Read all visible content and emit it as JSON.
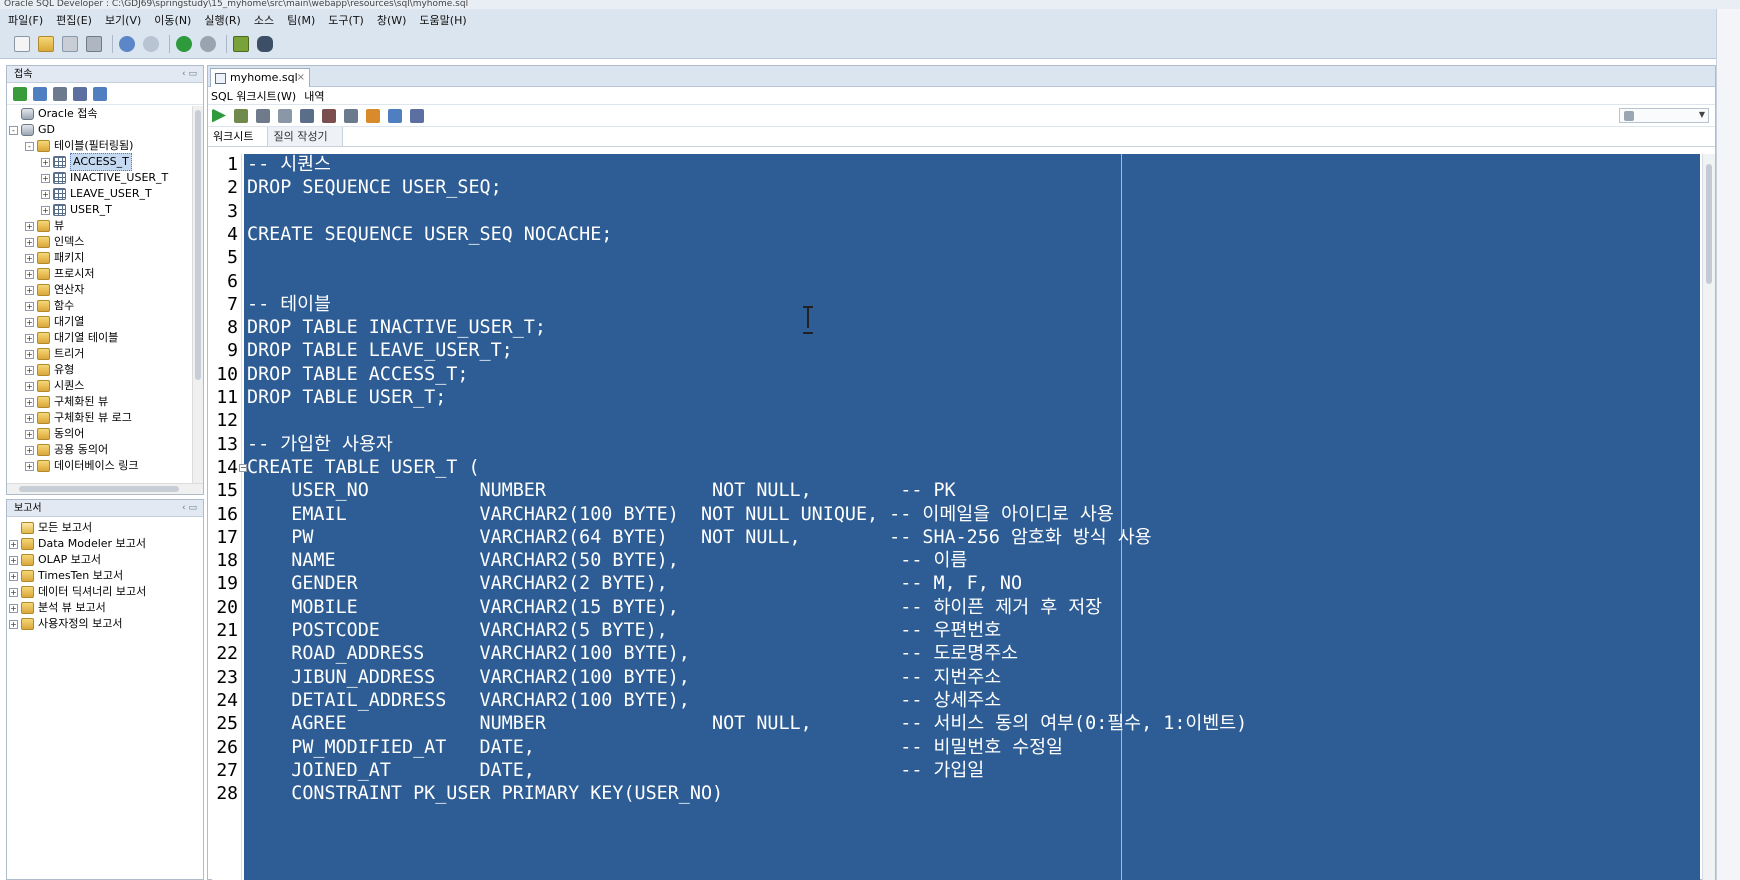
{
  "window": {
    "title": "Oracle SQL Developer : C:\\GDJ69\\springstudy\\15_myhome\\src\\main\\webapp\\resources\\sql\\myhome.sql"
  },
  "menu": [
    "파일(F)",
    "편집(E)",
    "보기(V)",
    "이동(N)",
    "실행(R)",
    "소스",
    "팀(M)",
    "도구(T)",
    "창(W)",
    "도움말(H)"
  ],
  "connections_panel": {
    "title": "접속",
    "tree": [
      {
        "label": "Oracle 접속",
        "level": 0,
        "icon": "db",
        "toggle": ""
      },
      {
        "label": "GD",
        "level": 0,
        "icon": "db",
        "toggle": "-"
      },
      {
        "label": "테이블(필터링됨)",
        "level": 1,
        "icon": "folder",
        "toggle": "-"
      },
      {
        "label": "ACCESS_T",
        "level": 2,
        "icon": "table",
        "toggle": "+",
        "selected": true
      },
      {
        "label": "INACTIVE_USER_T",
        "level": 2,
        "icon": "table",
        "toggle": "+"
      },
      {
        "label": "LEAVE_USER_T",
        "level": 2,
        "icon": "table",
        "toggle": "+"
      },
      {
        "label": "USER_T",
        "level": 2,
        "icon": "table",
        "toggle": "+"
      },
      {
        "label": "뷰",
        "level": 1,
        "icon": "folder",
        "toggle": "+"
      },
      {
        "label": "인덱스",
        "level": 1,
        "icon": "folder",
        "toggle": "+"
      },
      {
        "label": "패키지",
        "level": 1,
        "icon": "folder",
        "toggle": "+"
      },
      {
        "label": "프로시저",
        "level": 1,
        "icon": "folder",
        "toggle": "+"
      },
      {
        "label": "연산자",
        "level": 1,
        "icon": "folder",
        "toggle": "+"
      },
      {
        "label": "함수",
        "level": 1,
        "icon": "folder",
        "toggle": "+"
      },
      {
        "label": "대기열",
        "level": 1,
        "icon": "folder",
        "toggle": "+"
      },
      {
        "label": "대기열 테이블",
        "level": 1,
        "icon": "folder",
        "toggle": "+"
      },
      {
        "label": "트리거",
        "level": 1,
        "icon": "folder",
        "toggle": "+"
      },
      {
        "label": "유형",
        "level": 1,
        "icon": "folder",
        "toggle": "+"
      },
      {
        "label": "시퀀스",
        "level": 1,
        "icon": "folder",
        "toggle": "+"
      },
      {
        "label": "구체화된 뷰",
        "level": 1,
        "icon": "folder",
        "toggle": "+"
      },
      {
        "label": "구체화된 뷰 로그",
        "level": 1,
        "icon": "folder",
        "toggle": "+"
      },
      {
        "label": "동의어",
        "level": 1,
        "icon": "folder",
        "toggle": "+"
      },
      {
        "label": "공용 동의어",
        "level": 1,
        "icon": "folder",
        "toggle": "+"
      },
      {
        "label": "데이터베이스 링크",
        "level": 1,
        "icon": "folder",
        "toggle": "+"
      }
    ]
  },
  "reports_panel": {
    "title": "보고서",
    "tree": [
      {
        "label": "모든 보고서",
        "level": 0,
        "icon": "report",
        "toggle": ""
      },
      {
        "label": "Data Modeler 보고서",
        "level": 0,
        "icon": "folder",
        "toggle": "+"
      },
      {
        "label": "OLAP 보고서",
        "level": 0,
        "icon": "folder",
        "toggle": "+"
      },
      {
        "label": "TimesTen 보고서",
        "level": 0,
        "icon": "folder",
        "toggle": "+"
      },
      {
        "label": "데이터 딕셔너리 보고서",
        "level": 0,
        "icon": "folder",
        "toggle": "+"
      },
      {
        "label": "분석 뷰 보고서",
        "level": 0,
        "icon": "folder",
        "toggle": "+"
      },
      {
        "label": "사용자정의 보고서",
        "level": 0,
        "icon": "folder",
        "toggle": "+"
      }
    ]
  },
  "editor": {
    "file_tab": "myhome.sql",
    "sub_tabs": [
      "SQL 워크시트(W)",
      "내역"
    ],
    "worksheet_tabs": [
      "워크시트",
      "질의 작성기"
    ],
    "lines": [
      {
        "n": "1",
        "text": "-- 시퀀스"
      },
      {
        "n": "2",
        "text": "DROP SEQUENCE USER_SEQ;"
      },
      {
        "n": "3",
        "text": ""
      },
      {
        "n": "4",
        "text": "CREATE SEQUENCE USER_SEQ NOCACHE;"
      },
      {
        "n": "5",
        "text": ""
      },
      {
        "n": "6",
        "text": ""
      },
      {
        "n": "7",
        "text": "-- 테이블"
      },
      {
        "n": "8",
        "text": "DROP TABLE INACTIVE_USER_T;"
      },
      {
        "n": "9",
        "text": "DROP TABLE LEAVE_USER_T;"
      },
      {
        "n": "10",
        "text": "DROP TABLE ACCESS_T;"
      },
      {
        "n": "11",
        "text": "DROP TABLE USER_T;"
      },
      {
        "n": "12",
        "text": ""
      },
      {
        "n": "13",
        "text": "-- 가입한 사용자"
      },
      {
        "n": "14",
        "text": "CREATE TABLE USER_T (",
        "fold": true
      },
      {
        "n": "15",
        "text": "    USER_NO          NUMBER               NOT NULL,        -- PK"
      },
      {
        "n": "16",
        "text": "    EMAIL            VARCHAR2(100 BYTE)  NOT NULL UNIQUE, -- 이메일을 아이디로 사용"
      },
      {
        "n": "17",
        "text": "    PW               VARCHAR2(64 BYTE)   NOT NULL,        -- SHA-256 암호화 방식 사용"
      },
      {
        "n": "18",
        "text": "    NAME             VARCHAR2(50 BYTE),                    -- 이름"
      },
      {
        "n": "19",
        "text": "    GENDER           VARCHAR2(2 BYTE),                     -- M, F, NO"
      },
      {
        "n": "20",
        "text": "    MOBILE           VARCHAR2(15 BYTE),                    -- 하이픈 제거 후 저장"
      },
      {
        "n": "21",
        "text": "    POSTCODE         VARCHAR2(5 BYTE),                     -- 우편번호"
      },
      {
        "n": "22",
        "text": "    ROAD_ADDRESS     VARCHAR2(100 BYTE),                   -- 도로명주소"
      },
      {
        "n": "23",
        "text": "    JIBUN_ADDRESS    VARCHAR2(100 BYTE),                   -- 지번주소"
      },
      {
        "n": "24",
        "text": "    DETAIL_ADDRESS   VARCHAR2(100 BYTE),                   -- 상세주소"
      },
      {
        "n": "25",
        "text": "    AGREE            NUMBER               NOT NULL,        -- 서비스 동의 여부(0:필수, 1:이벤트)"
      },
      {
        "n": "26",
        "text": "    PW_MODIFIED_AT   DATE,                                 -- 비밀번호 수정일"
      },
      {
        "n": "27",
        "text": "    JOINED_AT        DATE,                                 -- 가입일"
      },
      {
        "n": "28",
        "text": "    CONSTRAINT PK_USER PRIMARY KEY(USER_NO)"
      }
    ]
  },
  "colors": {
    "selection": "#2d5d94",
    "chrome": "#dbe5f0",
    "panel_border": "#aebccd"
  }
}
